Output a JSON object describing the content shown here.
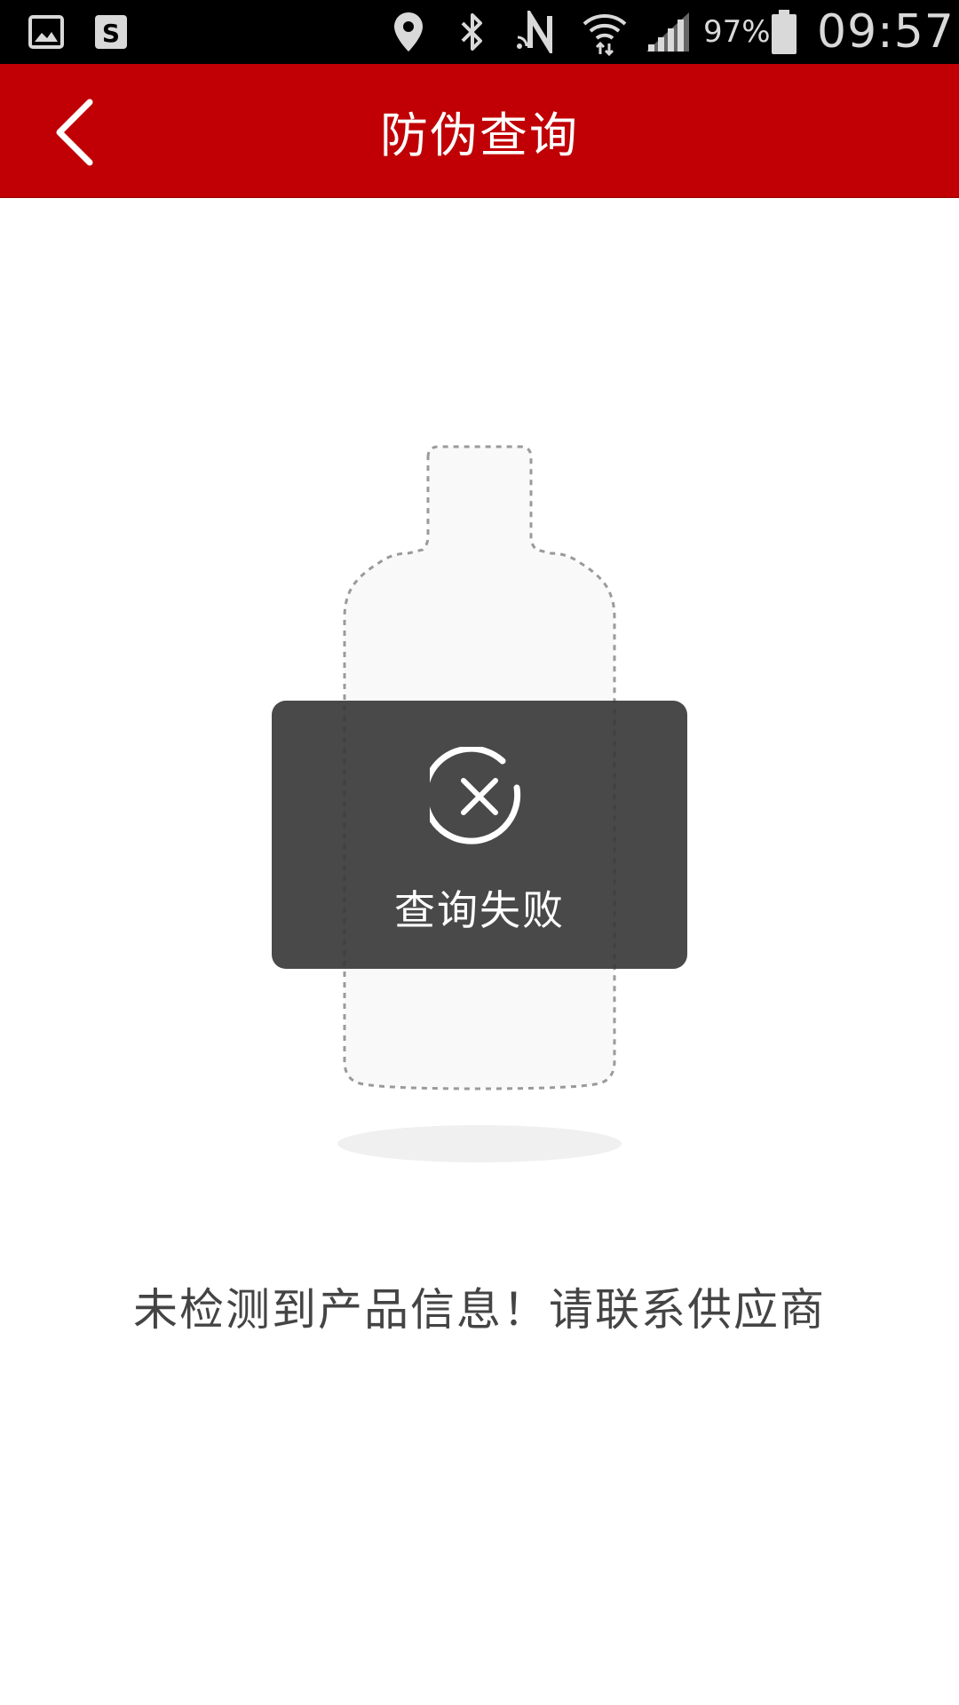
{
  "status_bar": {
    "icons": [
      "gallery-icon",
      "s-app-icon",
      "location-icon",
      "bluetooth-icon",
      "nfc-icon",
      "wifi-icon",
      "signal-icon",
      "battery-icon"
    ],
    "battery_percent": "97%",
    "time": "09:57"
  },
  "app_bar": {
    "title": "防伪查询",
    "back_icon": "chevron-left-icon",
    "background_color": "#c00004"
  },
  "toast": {
    "icon": "close-circle-icon",
    "text": "查询失败"
  },
  "illustration": {
    "icon": "bottle-outline-icon"
  },
  "message": "未检测到产品信息！请联系供应商"
}
